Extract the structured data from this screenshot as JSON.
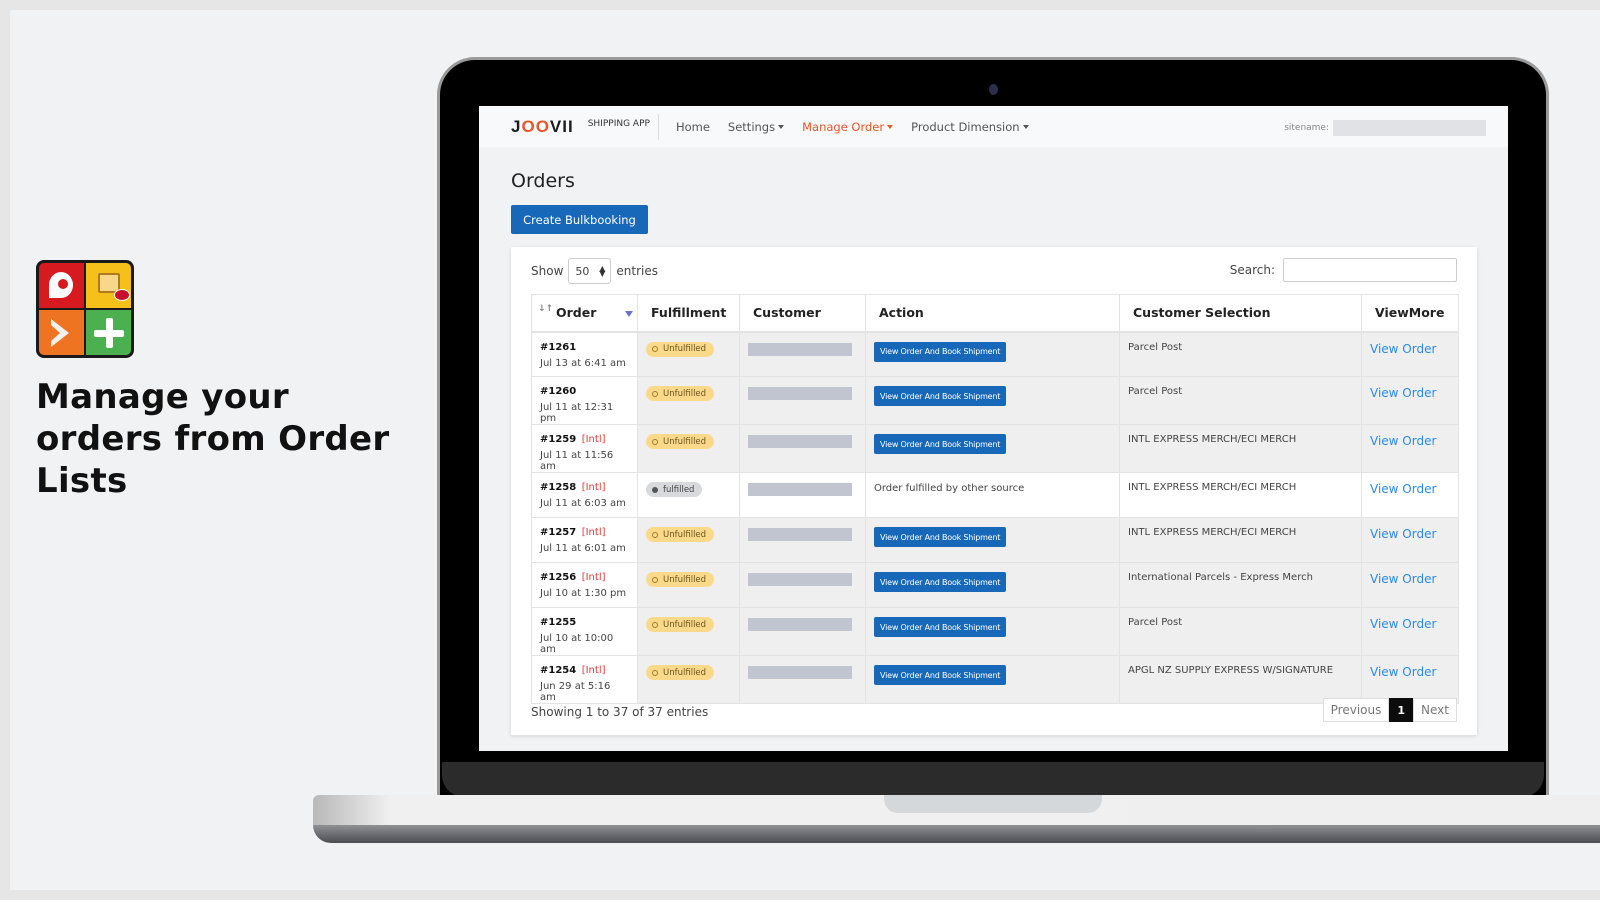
{
  "promo": {
    "headline": "Manage your orders from Order Lists",
    "logo_icon": "app-logo-icon"
  },
  "app": {
    "brand": "JOOVII",
    "brand_sub": "SHIPPING APP",
    "accent_color": "#e8562a",
    "primary_color": "#1768b9",
    "nav": [
      {
        "label": "Home",
        "dropdown": false,
        "active": false
      },
      {
        "label": "Settings",
        "dropdown": true,
        "active": false
      },
      {
        "label": "Manage Order",
        "dropdown": true,
        "active": true
      },
      {
        "label": "Product Dimension",
        "dropdown": true,
        "active": false
      }
    ],
    "sitename_label": "sitename:"
  },
  "page": {
    "title": "Orders",
    "bulk_button": "Create Bulkbooking"
  },
  "table_controls": {
    "show_label": "Show",
    "entries_label": "entries",
    "page_length": "50",
    "search_label": "Search:",
    "search_value": ""
  },
  "table": {
    "columns": [
      "Order",
      "Fulfillment",
      "Customer",
      "Action",
      "Customer Selection",
      "ViewMore"
    ],
    "rows": [
      {
        "order": "#1261",
        "intl": "",
        "date": "Jul 13 at 6:41 am",
        "fulfillment": "Unfulfilled",
        "action": "View Order And Book Shipment",
        "selection": "Parcel Post",
        "view": "View Order"
      },
      {
        "order": "#1260",
        "intl": "",
        "date": "Jul 11 at 12:31 pm",
        "fulfillment": "Unfulfilled",
        "action": "View Order And Book Shipment",
        "selection": "Parcel Post",
        "view": "View Order"
      },
      {
        "order": "#1259",
        "intl": "[Intl]",
        "date": "Jul 11 at 11:56 am",
        "fulfillment": "Unfulfilled",
        "action": "View Order And Book Shipment",
        "selection": "INTL EXPRESS MERCH/ECI MERCH",
        "view": "View Order"
      },
      {
        "order": "#1258",
        "intl": "[Intl]",
        "date": "Jul 11 at 6:03 am",
        "fulfillment": "fulfilled",
        "action_text": "Order fulfilled by other source",
        "selection": "INTL EXPRESS MERCH/ECI MERCH",
        "view": "View Order"
      },
      {
        "order": "#1257",
        "intl": "[Intl]",
        "date": "Jul 11 at 6:01 am",
        "fulfillment": "Unfulfilled",
        "action": "View Order And Book Shipment",
        "selection": "INTL EXPRESS MERCH/ECI MERCH",
        "view": "View Order"
      },
      {
        "order": "#1256",
        "intl": "[Intl]",
        "date": "Jul 10 at 1:30 pm",
        "fulfillment": "Unfulfilled",
        "action": "View Order And Book Shipment",
        "selection": "International Parcels - Express Merch",
        "view": "View Order"
      },
      {
        "order": "#1255",
        "intl": "",
        "date": "Jul 10 at 10:00 am",
        "fulfillment": "Unfulfilled",
        "action": "View Order And Book Shipment",
        "selection": "Parcel Post",
        "view": "View Order"
      },
      {
        "order": "#1254",
        "intl": "[Intl]",
        "date": "Jun 29 at 5:16 am",
        "fulfillment": "Unfulfilled",
        "action": "View Order And Book Shipment",
        "selection": "APGL NZ SUPPLY EXPRESS W/SIGNATURE",
        "view": "View Order"
      }
    ]
  },
  "footer": {
    "info": "Showing 1 to 37 of 37 entries",
    "previous": "Previous",
    "current_page": "1",
    "next": "Next"
  }
}
